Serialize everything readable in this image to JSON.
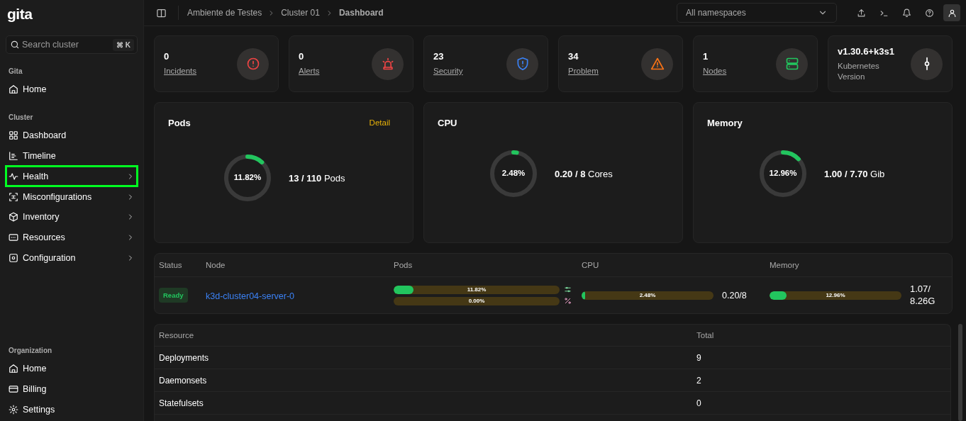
{
  "sidebar": {
    "logo": "gita",
    "search": {
      "placeholder": "Search cluster",
      "shortcut": [
        "⌘",
        "K"
      ]
    },
    "sections": [
      {
        "title": "Gita",
        "items": [
          {
            "label": "Home",
            "kind": "home",
            "has_children": false,
            "highlighted": false
          }
        ]
      },
      {
        "title": "Cluster",
        "items": [
          {
            "label": "Dashboard",
            "kind": "grid",
            "has_children": false,
            "highlighted": false
          },
          {
            "label": "Timeline",
            "kind": "timeline",
            "has_children": false,
            "highlighted": false
          },
          {
            "label": "Health",
            "kind": "pulse",
            "has_children": true,
            "highlighted": true
          },
          {
            "label": "Misconfigurations",
            "kind": "misconfig",
            "has_children": true,
            "highlighted": false
          },
          {
            "label": "Inventory",
            "kind": "box",
            "has_children": true,
            "highlighted": false
          },
          {
            "label": "Resources",
            "kind": "resources",
            "has_children": true,
            "highlighted": false
          },
          {
            "label": "Configuration",
            "kind": "config",
            "has_children": true,
            "highlighted": false
          }
        ]
      },
      {
        "title": "Organization",
        "items": [
          {
            "label": "Home",
            "kind": "home",
            "has_children": false,
            "highlighted": false
          },
          {
            "label": "Billing",
            "kind": "card",
            "has_children": false,
            "highlighted": false
          },
          {
            "label": "Settings",
            "kind": "gear",
            "has_children": false,
            "highlighted": false
          }
        ]
      }
    ]
  },
  "topbar": {
    "breadcrumbs": [
      {
        "label": "Ambiente de Testes",
        "current": false
      },
      {
        "label": "Cluster 01",
        "current": false
      },
      {
        "label": "Dashboard",
        "current": true
      }
    ],
    "namespace": {
      "value": "All namespaces"
    }
  },
  "stats": [
    {
      "value": "0",
      "label": "Incidents",
      "kind": "incident",
      "color": "#ef4444",
      "link": true
    },
    {
      "value": "0",
      "label": "Alerts",
      "kind": "alert",
      "color": "#ef4444",
      "link": true
    },
    {
      "value": "23",
      "label": "Security",
      "kind": "security",
      "color": "#3b82f6",
      "link": true
    },
    {
      "value": "34",
      "label": "Problem",
      "kind": "problem",
      "color": "#f97316",
      "link": true
    },
    {
      "value": "1",
      "label": "Nodes",
      "kind": "nodes",
      "color": "#22c55e",
      "link": true
    },
    {
      "value": "v1.30.6+k3s1",
      "label": "Kubernetes Version",
      "kind": "version",
      "color": "#ffffff",
      "link": false
    }
  ],
  "gauges": [
    {
      "title": "Pods",
      "action": "Detail",
      "level": 0.1182,
      "percent": "11.82%",
      "reading": "**13 / 110** Pods"
    },
    {
      "title": "CPU",
      "level": 0.0248,
      "percent": "2.48%",
      "reading": "**0.20 / 8** Cores"
    },
    {
      "title": "Memory",
      "level": 0.1296,
      "percent": "12.96%",
      "reading": "**1.00 / 7.70** Gib"
    }
  ],
  "nodes_table": {
    "columns": [
      "Status",
      "Node",
      "Pods",
      "CPU",
      "Memory"
    ],
    "rows": [
      {
        "status": "Ready",
        "node": "k3d-cluster04-server-0",
        "pods": [
          {
            "kind": "requests",
            "level": 0.1182,
            "label": "11.82%"
          },
          {
            "kind": "limits",
            "level": 0,
            "label": "0.00%"
          }
        ],
        "cpu": {
          "level": 0.0248,
          "label": "2.48%",
          "reading": "0.20/8"
        },
        "memory": {
          "level": 0.1296,
          "label": "12.96%",
          "reading": "1.07/8.26G"
        }
      }
    ]
  },
  "resources_table": {
    "columns": [
      "Resource",
      "Total"
    ],
    "rows": [
      [
        "Deployments",
        "9"
      ],
      [
        "Daemonsets",
        "2"
      ],
      [
        "Statefulsets",
        "0"
      ]
    ]
  }
}
